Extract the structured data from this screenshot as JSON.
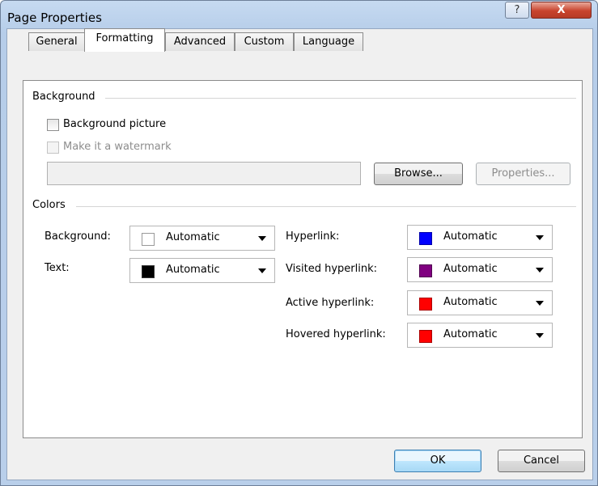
{
  "window": {
    "title": "Page Properties",
    "help_glyph": "?",
    "close_glyph": "X"
  },
  "tabs": [
    {
      "label": "General",
      "selected": false
    },
    {
      "label": "Formatting",
      "selected": true
    },
    {
      "label": "Advanced",
      "selected": false
    },
    {
      "label": "Custom",
      "selected": false
    },
    {
      "label": "Language",
      "selected": false
    }
  ],
  "background_group": {
    "label": "Background",
    "background_picture": {
      "label": "Background picture",
      "checked": false,
      "enabled": true
    },
    "watermark": {
      "label": "Make it a watermark",
      "checked": false,
      "enabled": false
    },
    "path_value": "",
    "browse_label": "Browse...",
    "properties_label": "Properties..."
  },
  "colors_group": {
    "label": "Colors",
    "background": {
      "label": "Background:",
      "value": "Automatic",
      "color": "#ffffff"
    },
    "text": {
      "label": "Text:",
      "value": "Automatic",
      "color": "#000000"
    },
    "hyperlink": {
      "label": "Hyperlink:",
      "value": "Automatic",
      "color": "#0000ff"
    },
    "visited_hyperlink": {
      "label": "Visited hyperlink:",
      "value": "Automatic",
      "color": "#800080"
    },
    "active_hyperlink": {
      "label": "Active hyperlink:",
      "value": "Automatic",
      "color": "#ff0000"
    },
    "hovered_hyperlink": {
      "label": "Hovered hyperlink:",
      "value": "Automatic",
      "color": "#ff0000"
    }
  },
  "buttons": {
    "ok_label": "OK",
    "cancel_label": "Cancel"
  }
}
